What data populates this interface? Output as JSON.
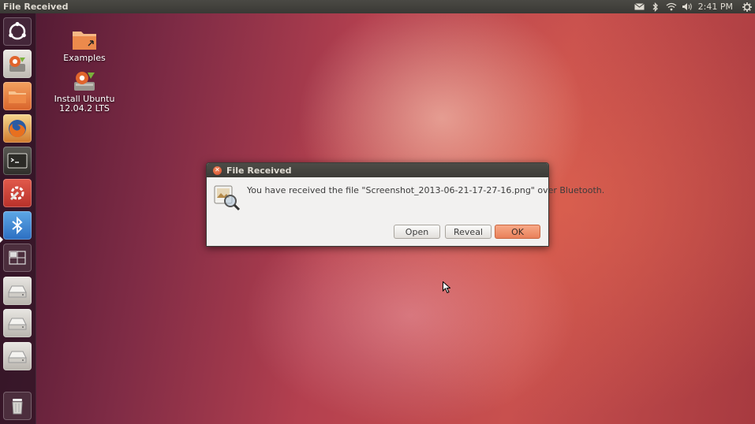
{
  "top_panel": {
    "window_title": "File Received",
    "clock": "2:41 PM",
    "indicators": [
      "mail-icon",
      "bluetooth-icon",
      "wifi-icon",
      "volume-icon",
      "session-gear-icon"
    ]
  },
  "launcher": {
    "items": [
      "dash-home-icon",
      "ubuntu-installer-icon",
      "files-icon",
      "firefox-icon",
      "terminal-icon",
      "system-settings-icon",
      "bluetooth-icon",
      "workspace-switcher-icon",
      "drive-icon",
      "drive-icon",
      "drive-icon",
      "trash-icon"
    ],
    "active_item": "bluetooth-icon"
  },
  "desktop": {
    "icons": [
      {
        "label": "Examples"
      },
      {
        "label_line1": "Install Ubuntu",
        "label_line2": "12.04.2 LTS"
      }
    ]
  },
  "dialog": {
    "title": "File Received",
    "message": "You have received the file \"Screenshot_2013-06-21-17-27-16.png\" over Bluetooth.",
    "buttons": {
      "open": "Open",
      "reveal": "Reveal",
      "ok": "OK"
    },
    "accent_color": "#e9805a"
  }
}
